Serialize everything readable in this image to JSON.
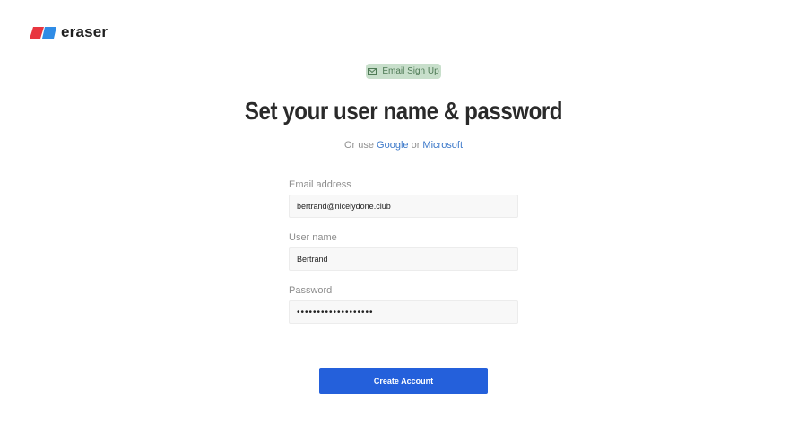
{
  "brand": {
    "name": "eraser",
    "colors": {
      "red": "#e8353f",
      "blue": "#2f8ce6"
    }
  },
  "badge": {
    "icon": "mail-icon",
    "label": "Email Sign Up"
  },
  "page": {
    "title": "Set your user name & password",
    "alt_prefix": "Or use",
    "alt_google": "Google",
    "alt_or": "or",
    "alt_microsoft": "Microsoft"
  },
  "form": {
    "email": {
      "label": "Email address",
      "value": "bertrand@nicelydone.club"
    },
    "username": {
      "label": "User name",
      "value": "Bertrand"
    },
    "password": {
      "label": "Password",
      "value": "•••••••••••••••••••"
    }
  },
  "actions": {
    "create_label": "Create Account"
  },
  "colors": {
    "accent": "#2460db",
    "badge_bg": "#c8dfcb",
    "link": "#3b78c9"
  }
}
